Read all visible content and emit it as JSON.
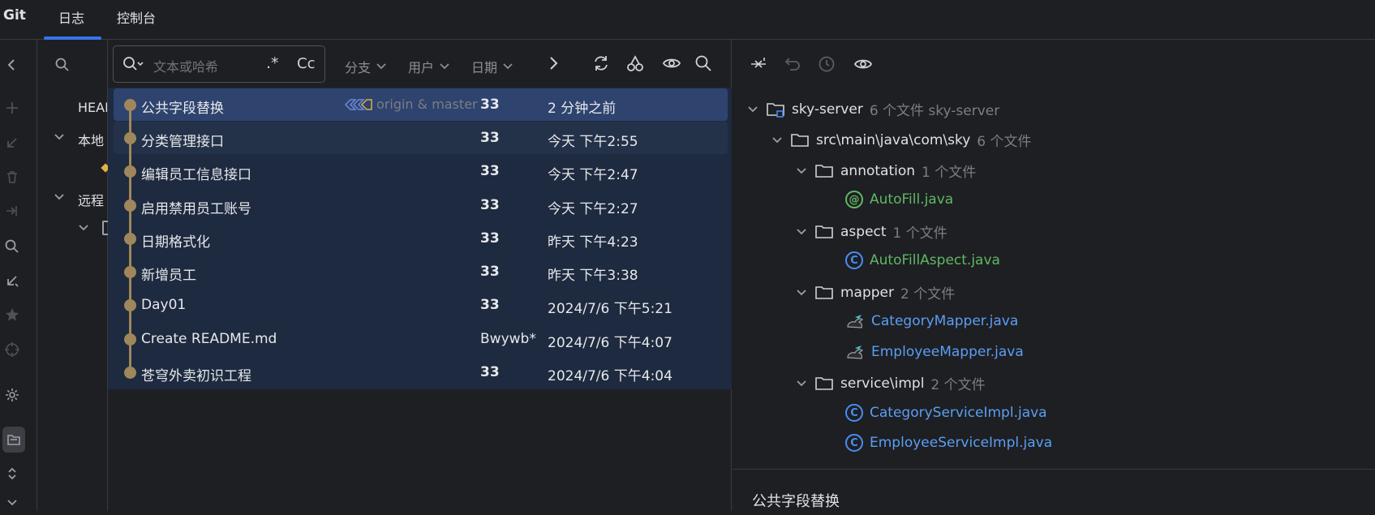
{
  "app": {
    "title": "Git"
  },
  "tabs": [
    {
      "label": "日志",
      "active": true
    },
    {
      "label": "控制台",
      "active": false
    }
  ],
  "branches": {
    "head": "HEAD",
    "local": "本地",
    "remote": "远程"
  },
  "toolbar": {
    "search_placeholder": "文本或哈希",
    "regex_label": ".*",
    "case_label": "Cc",
    "filter_branch": "分支",
    "filter_user": "用户",
    "filter_date": "日期"
  },
  "commits": [
    {
      "message": "公共字段替换",
      "refs": "origin & master",
      "author": "33",
      "date": "2 分钟之前"
    },
    {
      "message": "分类管理接口",
      "refs": "",
      "author": "33",
      "date": "今天 下午2:55"
    },
    {
      "message": "编辑员工信息接口",
      "refs": "",
      "author": "33",
      "date": "今天 下午2:47"
    },
    {
      "message": "启用禁用员工账号",
      "refs": "",
      "author": "33",
      "date": "今天 下午2:27"
    },
    {
      "message": "日期格式化",
      "refs": "",
      "author": "33",
      "date": "昨天 下午4:23"
    },
    {
      "message": "新增员工",
      "refs": "",
      "author": "33",
      "date": "昨天 下午3:38"
    },
    {
      "message": "Day01",
      "refs": "",
      "author": "33",
      "date": "2024/7/6 下午5:21"
    },
    {
      "message": "Create README.md",
      "refs": "",
      "author": "Bwywb*",
      "date": "2024/7/6 下午4:07"
    },
    {
      "message": "苍穹外卖初识工程",
      "refs": "",
      "author": "33",
      "date": "2024/7/6 下午4:04"
    }
  ],
  "tree": {
    "root": {
      "name": "sky-server",
      "meta": "6 个文件 sky-server"
    },
    "src": {
      "name": "src\\main\\java\\com\\sky",
      "meta": "6 个文件"
    },
    "annotation": {
      "name": "annotation",
      "meta": "1 个文件"
    },
    "autofill": "AutoFill.java",
    "aspect": {
      "name": "aspect",
      "meta": "1 个文件"
    },
    "autofillaspect": "AutoFillAspect.java",
    "mapper": {
      "name": "mapper",
      "meta": "2 个文件"
    },
    "categorymapper": "CategoryMapper.java",
    "employeemapper": "EmployeeMapper.java",
    "service": {
      "name": "service\\impl",
      "meta": "2 个文件"
    },
    "categoryservice": "CategoryServiceImpl.java",
    "employeeservice": "EmployeeServiceImpl.java"
  },
  "detail": {
    "title": "公共字段替换"
  },
  "colors": {
    "accent": "#3574f0",
    "graph": "#a0875b",
    "selected": "#2e436e"
  }
}
